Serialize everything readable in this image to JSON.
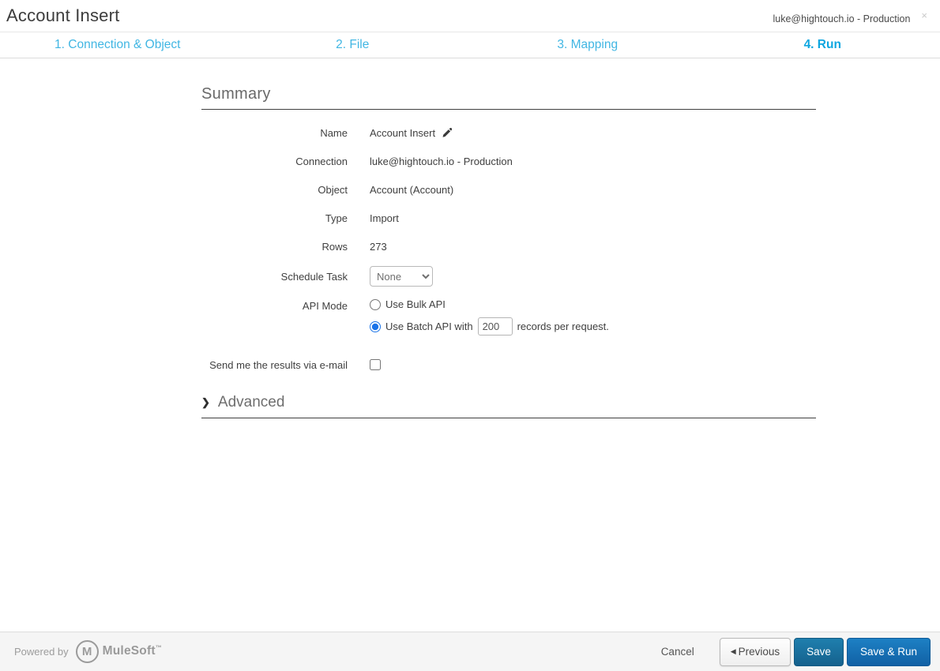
{
  "header": {
    "title": "Account Insert",
    "connection": "luke@hightouch.io - Production",
    "close_icon": "×"
  },
  "steps": [
    {
      "label": "1. Connection & Object",
      "active": false
    },
    {
      "label": "2. File",
      "active": false
    },
    {
      "label": "3. Mapping",
      "active": false
    },
    {
      "label": "4. Run",
      "active": true
    }
  ],
  "summary": {
    "heading": "Summary",
    "name": {
      "label": "Name",
      "value": "Account Insert"
    },
    "connection": {
      "label": "Connection",
      "value": "luke@hightouch.io - Production"
    },
    "object": {
      "label": "Object",
      "value": "Account (Account)"
    },
    "type": {
      "label": "Type",
      "value": "Import"
    },
    "rows": {
      "label": "Rows",
      "value": "273"
    },
    "schedule": {
      "label": "Schedule Task",
      "selected_option": "None"
    },
    "api_mode": {
      "label": "API Mode",
      "bulk": {
        "label": "Use Bulk API",
        "selected": false
      },
      "batch": {
        "label_before": "Use Batch API with",
        "records_value": "200",
        "label_after": "records per request.",
        "selected": true
      }
    },
    "email": {
      "label": "Send me the results via e-mail",
      "checked": false
    }
  },
  "advanced": {
    "chevron": "❯",
    "label": "Advanced"
  },
  "footer": {
    "powered_by": "Powered by",
    "brand": "MuleSoft",
    "brand_tm": "™",
    "cancel": "Cancel",
    "previous_arrow": "◀",
    "previous": "Previous",
    "save": "Save",
    "save_run": "Save & Run"
  },
  "colors": {
    "tab_blue": "#41b6e3",
    "active_tab_blue": "#0da6e0",
    "save_button": "#15618d",
    "save_run_button": "#1161a5",
    "footer_bg": "#f5f5f5"
  }
}
